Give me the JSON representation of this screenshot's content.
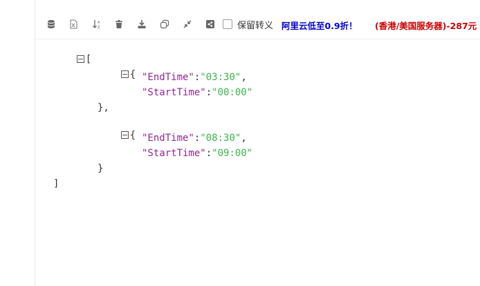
{
  "toolbar": {
    "icons": [
      "database-icon",
      "excel-icon",
      "sort-icon",
      "trash-icon",
      "download-icon",
      "copy-icon",
      "compress-icon",
      "share-icon"
    ],
    "checkbox_label": "保留转义",
    "promo_blue": "阿里云低至0.9折！",
    "promo_red": "(香港/美国服务器)-287元"
  },
  "json": {
    "open_bracket": "[",
    "close_bracket": "]",
    "open_brace": "{",
    "close_brace": "}",
    "close_brace_comma": "},",
    "items": [
      {
        "k1": "\"EndTime\"",
        "v1": "\"03:30\"",
        "k2": "\"StartTime\"",
        "v2": "\"00:00\""
      },
      {
        "k1": "\"EndTime\"",
        "v1": "\"08:30\"",
        "k2": "\"StartTime\"",
        "v2": "\"09:00\""
      }
    ],
    "colon": ":",
    "comma": ","
  }
}
